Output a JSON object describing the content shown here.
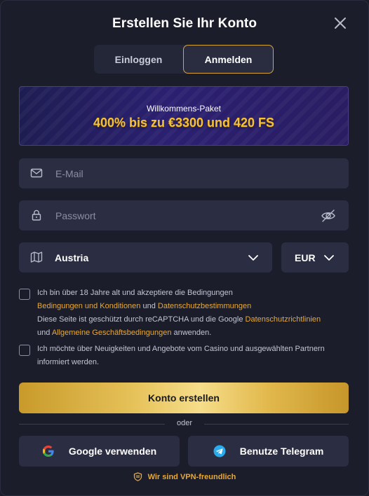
{
  "modal": {
    "title": "Erstellen Sie Ihr Konto",
    "close_icon": "close-icon"
  },
  "tabs": [
    {
      "label": "Einloggen",
      "active": false
    },
    {
      "label": "Anmelden",
      "active": true
    }
  ],
  "promo": {
    "subtitle": "Willkommens-Paket",
    "headline": "400% bis zu €3300 und 420 FS"
  },
  "email": {
    "icon": "mail-icon",
    "placeholder": "E-Mail",
    "value": ""
  },
  "password": {
    "icon": "lock-icon",
    "placeholder": "Passwort",
    "value": "",
    "toggle_icon": "eye-off-icon"
  },
  "country": {
    "icon": "map-icon",
    "value": "Austria"
  },
  "currency": {
    "value": "EUR"
  },
  "consent": {
    "line1": "Ich bin über 18 Jahre alt und akzeptiere die Bedingungen",
    "terms_link": "Bedingungen und Konditionen",
    "and1": "und",
    "privacy_link": "Datenschutzbestimmungen",
    "recaptcha_text": "Diese Seite ist geschützt durch reCAPTCHA und die Google",
    "google_privacy_link": "Datenschutzrichtlinien",
    "and2": "und",
    "google_terms_link": "Allgemeine Geschäftsbedingungen",
    "apply": "anwenden."
  },
  "newsletter": {
    "text": "Ich möchte über Neuigkeiten und Angebote vom Casino und ausgewählten Partnern informiert werden."
  },
  "create_button": "Konto erstellen",
  "or_label": "oder",
  "google_button": "Google verwenden",
  "telegram_button": "Benutze Telegram",
  "vpn_note": "Wir sind VPN-freundlich",
  "colors": {
    "accent": "#e7a938",
    "background": "#1b1d2b",
    "field": "#2b2e42",
    "promo_text": "#f4c23a"
  }
}
